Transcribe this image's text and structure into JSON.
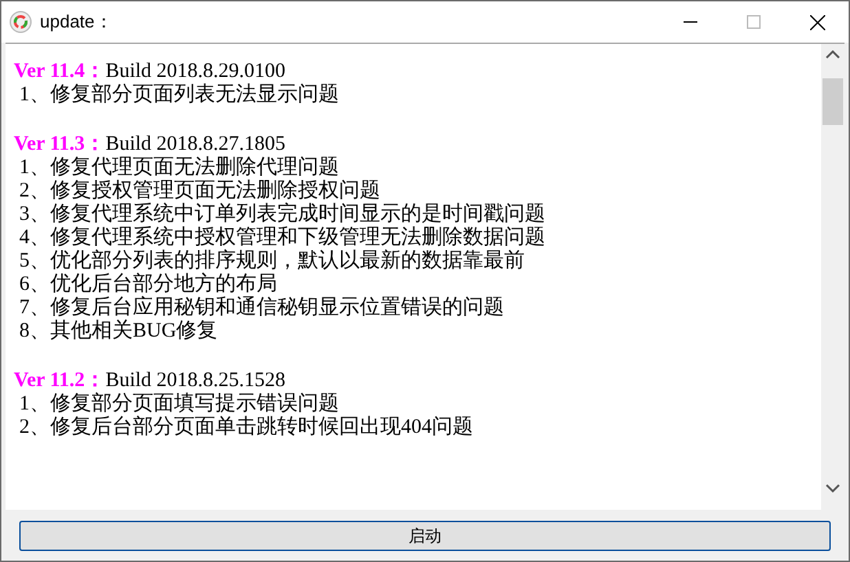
{
  "window": {
    "title": "update："
  },
  "releases": [
    {
      "version": "Ver 11.4：",
      "build": "Build 2018.8.29.0100",
      "items": [
        "1、修复部分页面列表无法显示问题"
      ]
    },
    {
      "version": "Ver 11.3：",
      "build": "Build 2018.8.27.1805",
      "items": [
        "1、修复代理页面无法删除代理问题",
        "2、修复授权管理页面无法删除授权问题",
        "3、修复代理系统中订单列表完成时间显示的是时间戳问题",
        "4、修复代理系统中授权管理和下级管理无法删除数据问题",
        "5、优化部分列表的排序规则，默认以最新的数据靠最前",
        "6、优化后台部分地方的布局",
        "7、修复后台应用秘钥和通信秘钥显示位置错误的问题",
        "8、其他相关BUG修复"
      ]
    },
    {
      "version": "Ver 11.2：",
      "build": "Build 2018.8.25.1528",
      "items": [
        "1、修复部分页面填写提示错误问题",
        "2、修复后台部分页面单击跳转时候回出现404问题"
      ]
    }
  ],
  "button": "启动"
}
